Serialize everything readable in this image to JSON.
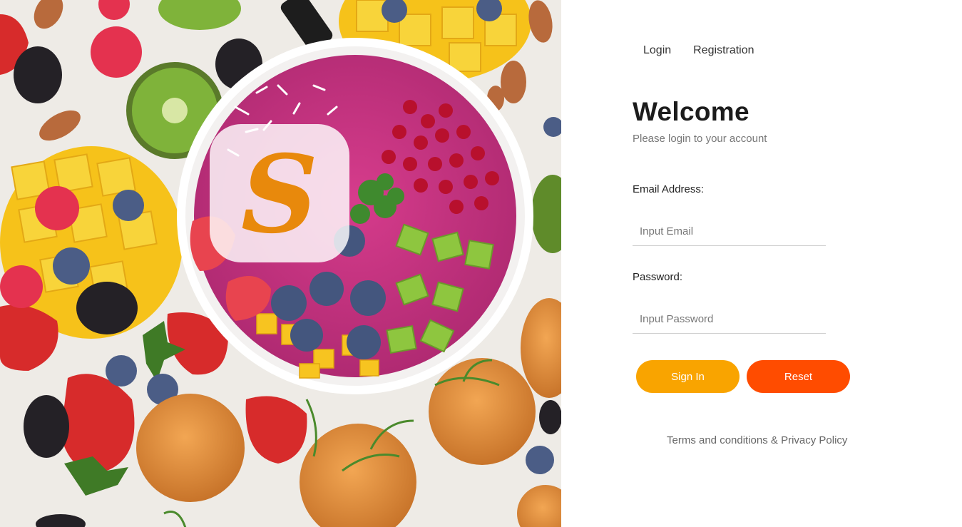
{
  "nav": {
    "login": "Login",
    "registration": "Registration"
  },
  "header": {
    "title": "Welcome",
    "subtitle": "Please login to your account"
  },
  "form": {
    "email_label": "Email Address:",
    "email_placeholder": "Input Email",
    "password_label": "Password:",
    "password_placeholder": "Input Password",
    "signin_label": "Sign In",
    "reset_label": "Reset"
  },
  "footer": {
    "terms": "Terms and conditions & Privacy Policy"
  },
  "colors": {
    "signin": "#f9a400",
    "reset": "#ff4c00",
    "logo": "#e8890c"
  },
  "icons": {
    "logo": "brand-s-logo-icon"
  }
}
